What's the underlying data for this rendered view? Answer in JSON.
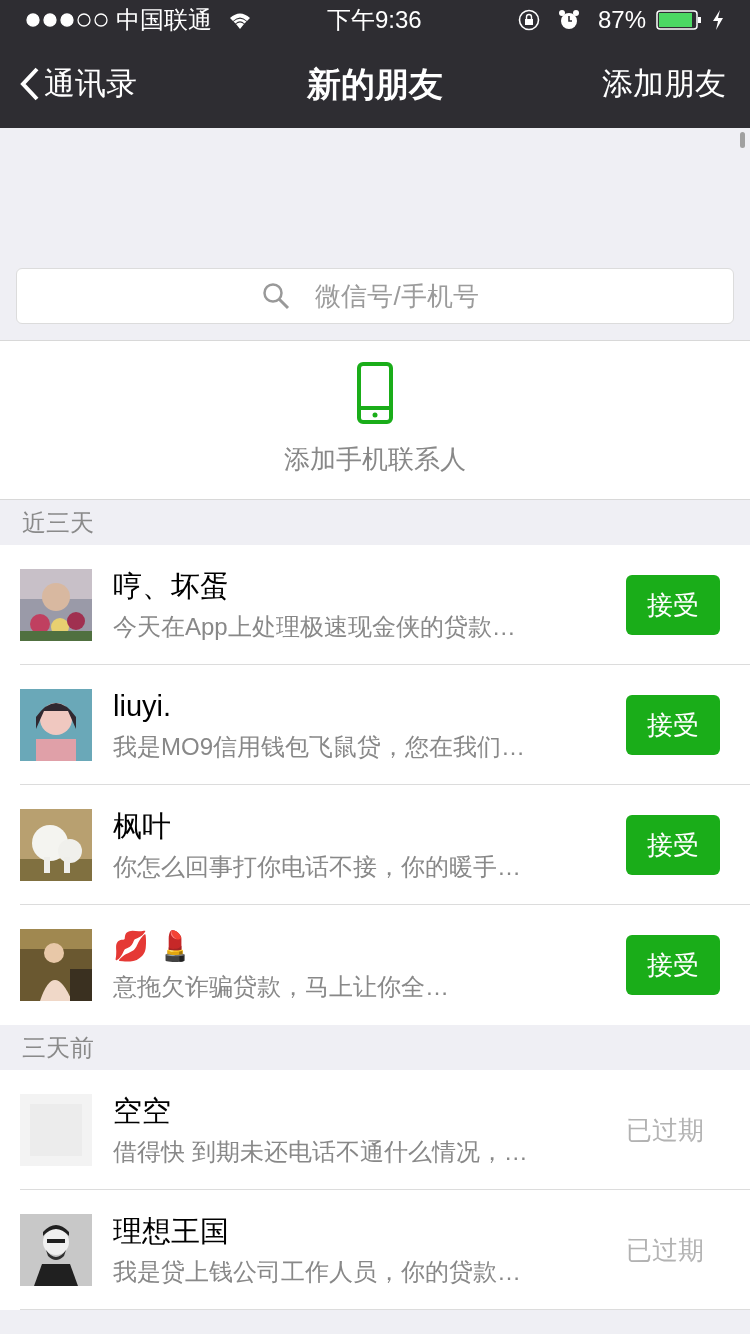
{
  "status_bar": {
    "carrier": "中国联通",
    "time": "下午9:36",
    "battery": "87%"
  },
  "nav": {
    "back": "通讯录",
    "title": "新的朋友",
    "action": "添加朋友"
  },
  "search": {
    "placeholder": "微信号/手机号"
  },
  "add_contacts": {
    "label": "添加手机联系人"
  },
  "sections": [
    {
      "title": "近三天",
      "rows": [
        {
          "name": "哼、坏蛋",
          "message": "今天在App上处理极速现金侠的贷款…",
          "kind": "accept",
          "action": "接受"
        },
        {
          "name": "liuyi.",
          "message": "我是MO9信用钱包飞鼠贷，您在我们…",
          "kind": "accept",
          "action": "接受"
        },
        {
          "name": "枫叶",
          "message": "你怎么回事打你电话不接，你的暖手…",
          "kind": "accept",
          "action": "接受"
        },
        {
          "name": "💋 💄",
          "message": "意拖欠诈骗贷款，马上让你全…",
          "kind": "accept",
          "action": "接受"
        }
      ]
    },
    {
      "title": "三天前",
      "rows": [
        {
          "name": "空空",
          "message": "借得快 到期未还电话不通什么情况，…",
          "kind": "expired",
          "action": "已过期"
        },
        {
          "name": "理想王国",
          "message": "我是贷上钱公司工作人员，你的贷款…",
          "kind": "expired",
          "action": "已过期"
        }
      ]
    }
  ]
}
